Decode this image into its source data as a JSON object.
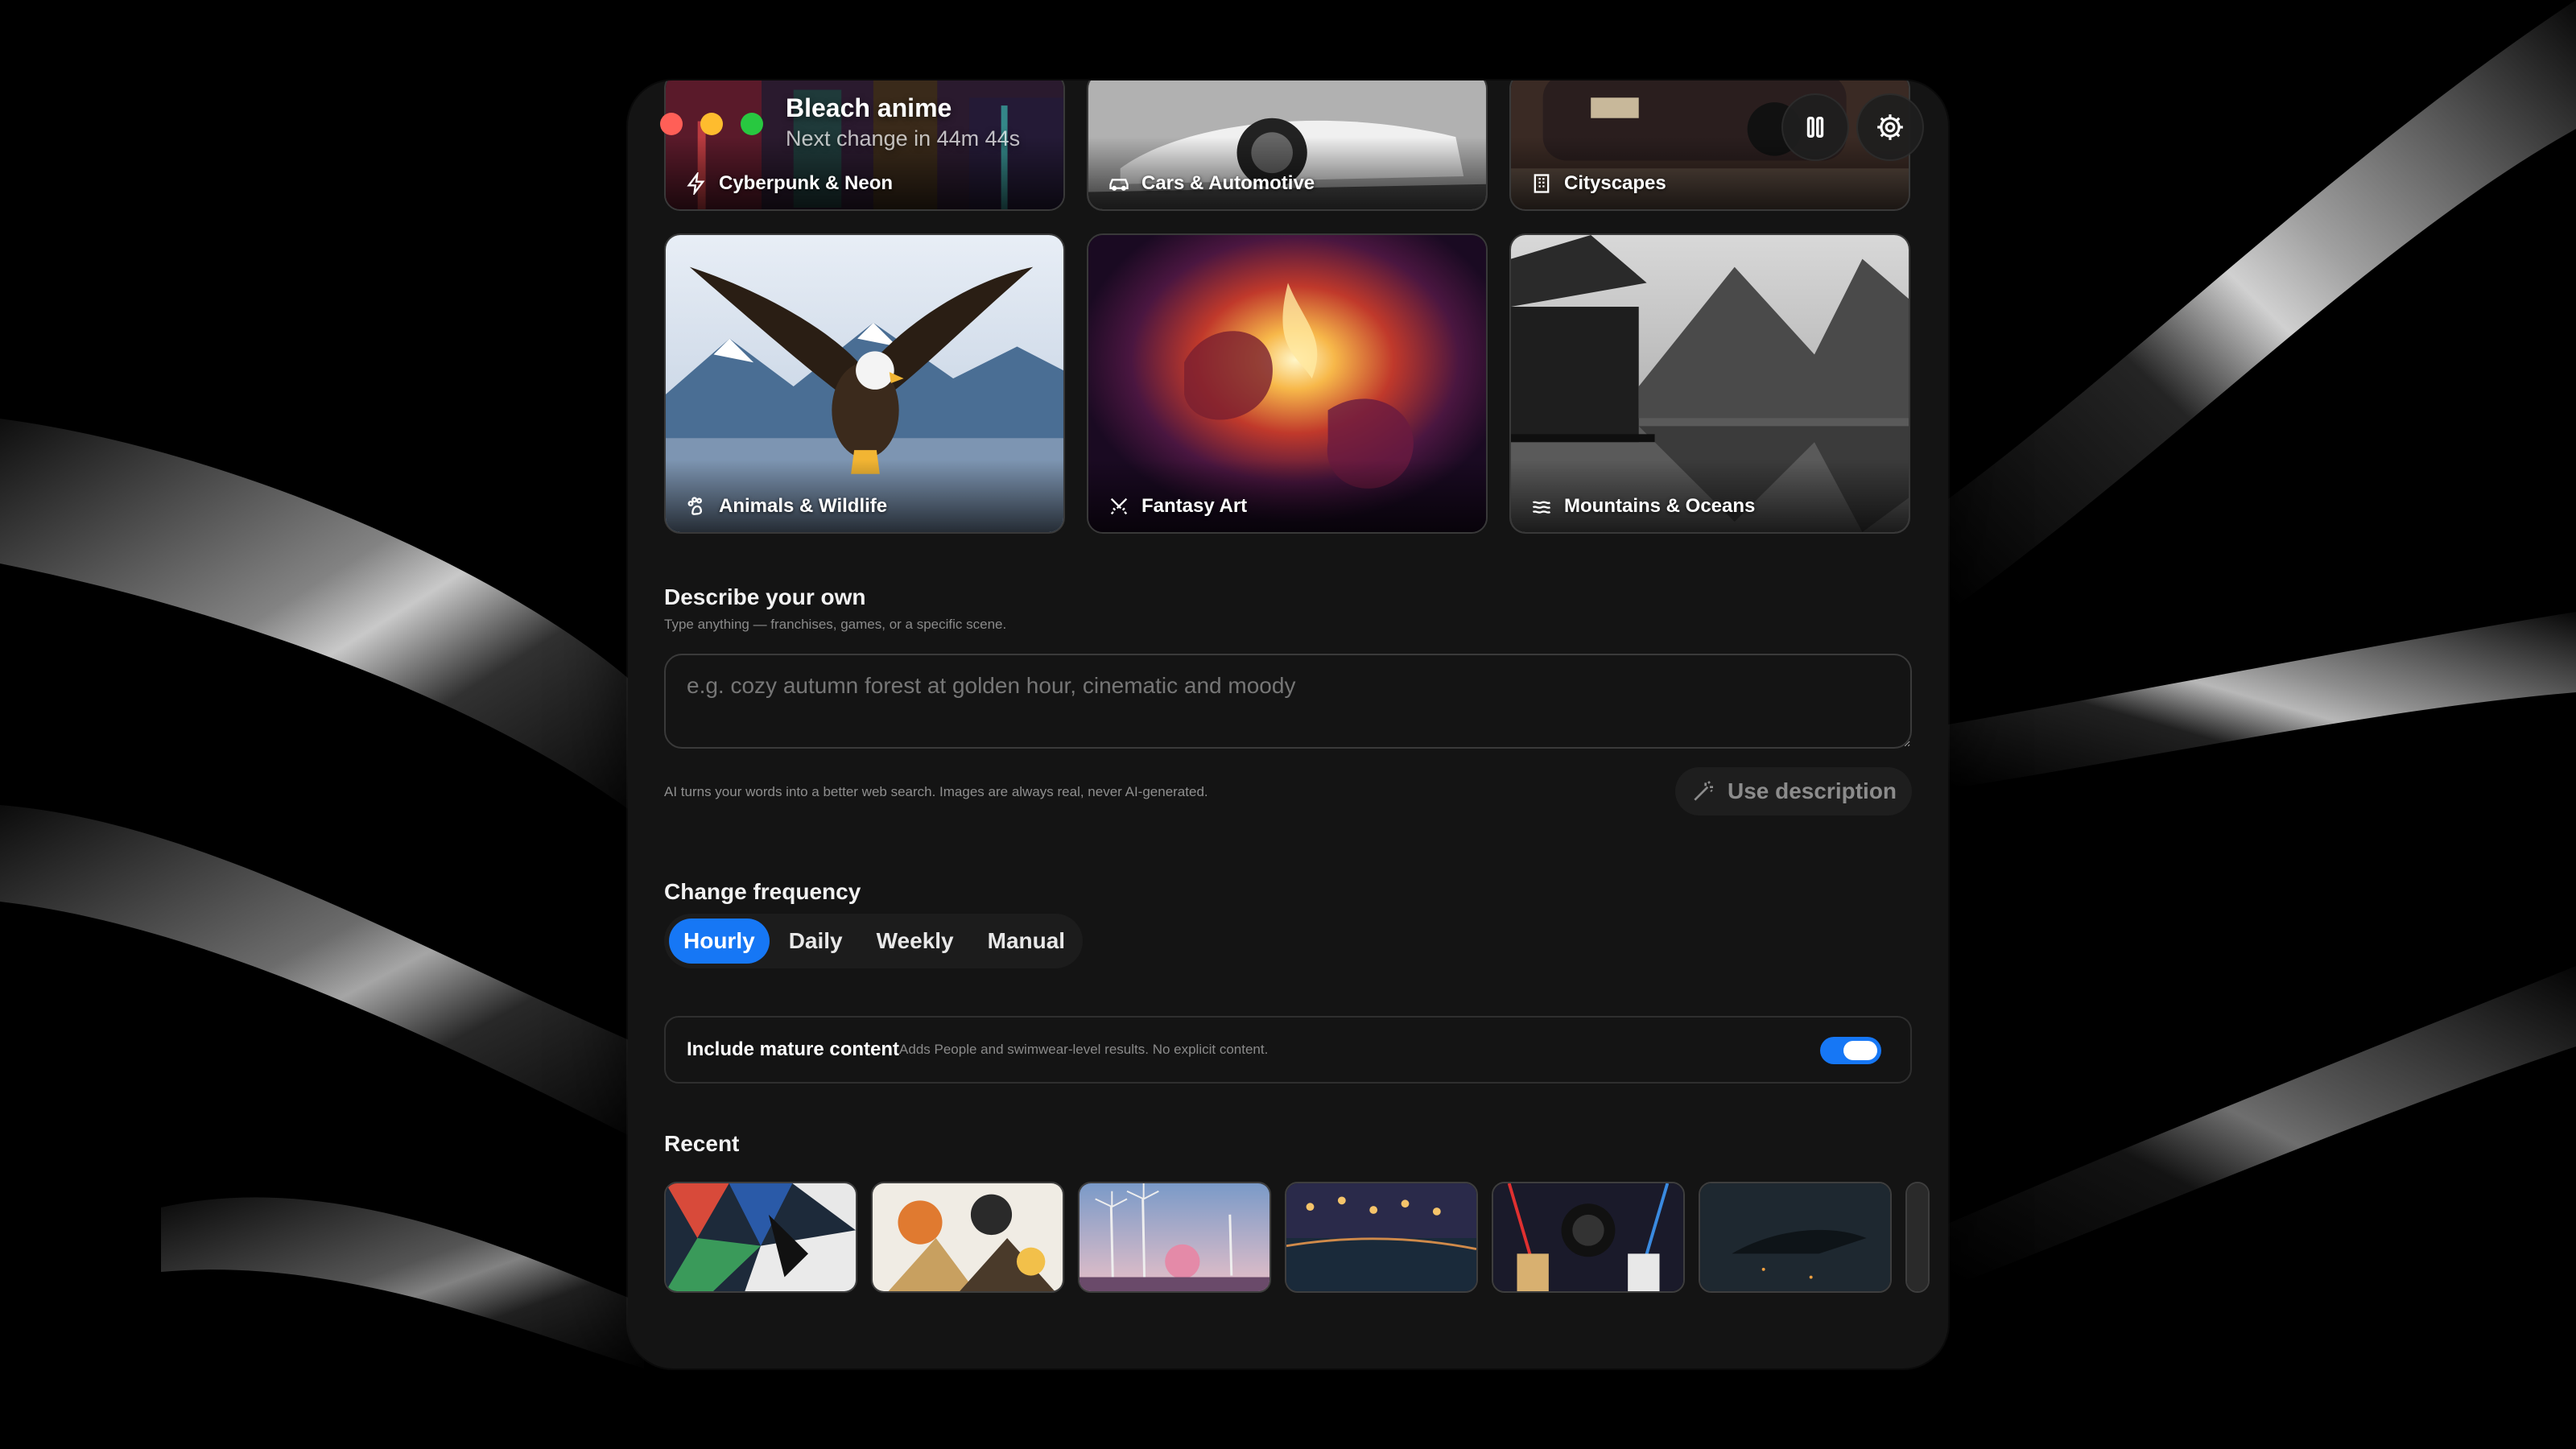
{
  "header": {
    "title": "Bleach anime",
    "subtitle": "Next change in 44m 44s"
  },
  "categories": [
    {
      "label": "Cyberpunk & Neon",
      "icon": "bolt-icon"
    },
    {
      "label": "Cars & Automotive",
      "icon": "car-icon"
    },
    {
      "label": "Cityscapes",
      "icon": "building-icon"
    },
    {
      "label": "Animals & Wildlife",
      "icon": "paw-icon"
    },
    {
      "label": "Fantasy Art",
      "icon": "swords-icon"
    },
    {
      "label": "Mountains & Oceans",
      "icon": "waves-icon"
    }
  ],
  "describe": {
    "title": "Describe your own",
    "subtitle": "Type anything — franchises, games, or a specific scene.",
    "placeholder": "e.g. cozy autumn forest at golden hour, cinematic and moody",
    "value": "",
    "hint": "AI turns your words into a better web search. Images are always real, never AI-generated.",
    "button_label": "Use description"
  },
  "frequency": {
    "title": "Change frequency",
    "options": [
      "Hourly",
      "Daily",
      "Weekly",
      "Manual"
    ],
    "selected": "Hourly"
  },
  "mature": {
    "title": "Include mature content",
    "subtitle": "Adds People and swimwear-level results. No explicit content.",
    "enabled": true
  },
  "recent": {
    "title": "Recent"
  },
  "colors": {
    "accent": "#1677f5",
    "panel": "#141414",
    "traffic_red": "#ff5f57",
    "traffic_yellow": "#febc2e",
    "traffic_green": "#28c840"
  }
}
